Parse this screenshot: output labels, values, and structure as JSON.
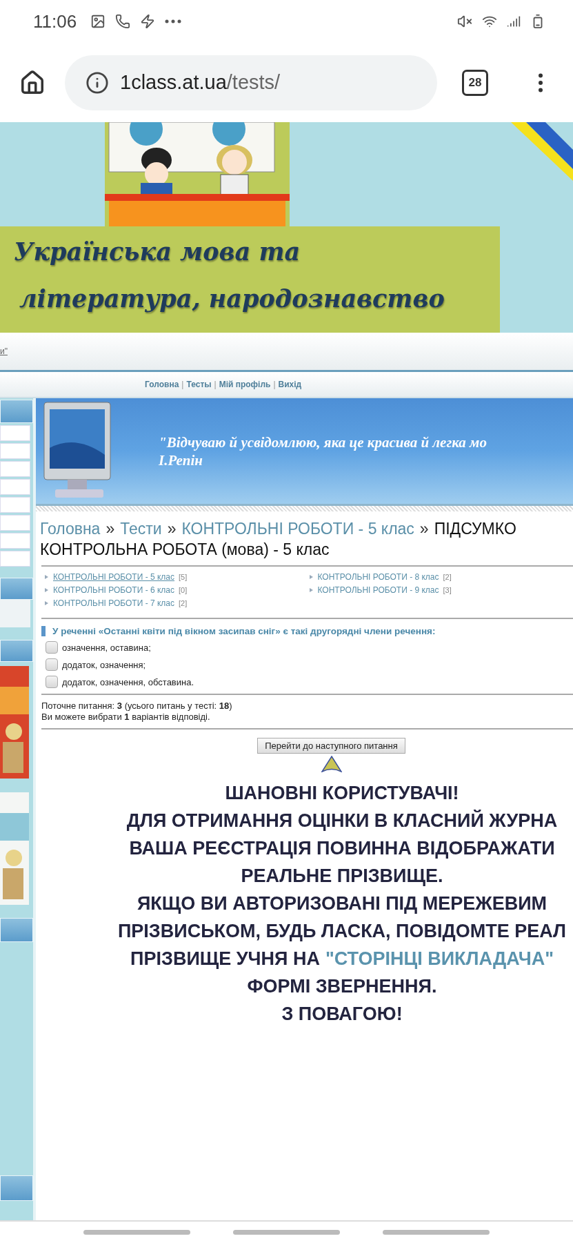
{
  "status_bar": {
    "time": "11:06"
  },
  "browser": {
    "url_host": "1class.at.ua",
    "url_path": "/tests/",
    "tab_count": "28"
  },
  "header": {
    "title_lines": [
      "Українська мова та",
      "література, народознавство"
    ],
    "cut_link": "и\""
  },
  "nav": [
    {
      "kind": "link",
      "label": "Головна"
    },
    {
      "kind": "separator",
      "label": "|"
    },
    {
      "kind": "link",
      "label": "Тесты"
    },
    {
      "kind": "separator",
      "label": "|"
    },
    {
      "kind": "link",
      "label": "Мій профіль"
    },
    {
      "kind": "separator",
      "label": "|"
    },
    {
      "kind": "link",
      "label": "Вихід"
    }
  ],
  "quote": {
    "text": "\"Відчуваю й усвідомлюю, яка це красива й легка мо",
    "author": "І.Репін"
  },
  "breadcrumb": [
    {
      "kind": "link",
      "label": "Головна"
    },
    {
      "kind": "separator",
      "label": "»"
    },
    {
      "kind": "link",
      "label": "Тести"
    },
    {
      "kind": "separator",
      "label": "»"
    },
    {
      "kind": "link",
      "label": "КОНТРОЛЬНІ РОБОТИ - 5 клас"
    },
    {
      "kind": "separator",
      "label": "»"
    },
    {
      "kind": "current",
      "label": "ПІДСУМКО"
    },
    {
      "kind": "current",
      "label": "КОНТРОЛЬНА РОБОТА (мова) - 5 клас"
    }
  ],
  "categories": {
    "columns": [
      [
        {
          "label": "КОНТРОЛЬНІ РОБОТИ - 5 клас",
          "count": "[5]",
          "underlined": true
        },
        {
          "label": "КОНТРОЛЬНІ РОБОТИ - 6 клас",
          "count": "[0]",
          "underlined": false
        },
        {
          "label": "КОНТРОЛЬНІ РОБОТИ - 7 клас",
          "count": "[2]",
          "underlined": false
        }
      ],
      [
        {
          "label": "КОНТРОЛЬНІ РОБОТИ - 8 клас",
          "count": "[2]",
          "underlined": false
        },
        {
          "label": "КОНТРОЛЬНІ РОБОТИ - 9 клас",
          "count": "[3]",
          "underlined": false
        }
      ]
    ]
  },
  "question": {
    "text": "У реченні «Останні квіти під вікном засипав сніг» є такі другорядні члени речення:",
    "options": [
      {
        "label": "означення, оставина;",
        "checked": false
      },
      {
        "label": "додаток, означення;",
        "checked": false
      },
      {
        "label": "додаток, означення, обставина.",
        "checked": false
      }
    ]
  },
  "progress": [
    "Поточне питання: **3** (усього питань у тесті: **18**)",
    "Ви можете вибрати **1** варіантів відповіді."
  ],
  "next_button": "Перейти до наступного питання",
  "notice": [
    {
      "text": "ШАНОВНІ КОРИСТУВАЧІ!"
    },
    {
      "text": "ДЛЯ ОТРИМАННЯ ОЦІНКИ В КЛАСНИЙ ЖУРНА"
    },
    {
      "text": "ВАША РЕЄСТРАЦІЯ ПОВИННА ВІДОБРАЖАТИ"
    },
    {
      "text": "РЕАЛЬНЕ ПРІЗВИЩЕ."
    },
    {
      "text": "ЯКЩО ВИ АВТОРИЗОВАНІ ПІД МЕРЕЖЕВИМ"
    },
    {
      "text": "ПРІЗВИСЬКОМ, БУДЬ ЛАСКА, ПОВІДОМТЕ РЕАЛ"
    },
    {
      "text": "ПРІЗВИЩЕ УЧНЯ НА",
      "link": "\"СТОРІНЦІ ВИКЛАДАЧА\""
    },
    {
      "text": "ФОРМІ ЗВЕРНЕННЯ."
    },
    {
      "text": "З ПОВАГОЮ!"
    }
  ]
}
